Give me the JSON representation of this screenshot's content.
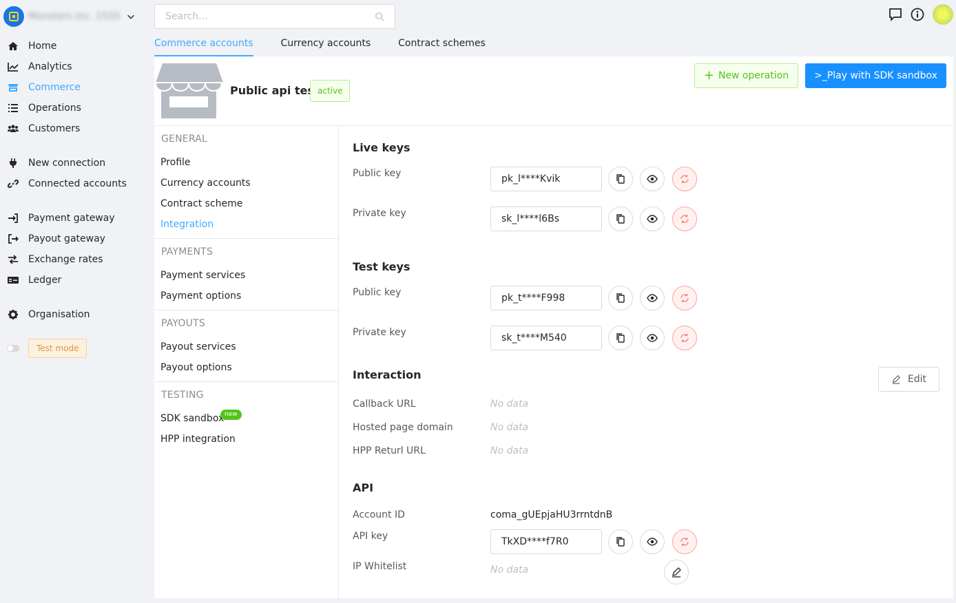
{
  "org": {
    "name": "Monsters Inc. 1555"
  },
  "sidebar": {
    "items": [
      {
        "label": "Home",
        "icon": "home-icon"
      },
      {
        "label": "Analytics",
        "icon": "chart-line-icon"
      },
      {
        "label": "Commerce",
        "icon": "store-icon"
      },
      {
        "label": "Operations",
        "icon": "list-icon"
      },
      {
        "label": "Customers",
        "icon": "users-icon"
      },
      {
        "label": "New connection",
        "icon": "plug-icon"
      },
      {
        "label": "Connected accounts",
        "icon": "link-icon"
      },
      {
        "label": "Payment gateway",
        "icon": "sign-in-icon"
      },
      {
        "label": "Payout gateway",
        "icon": "sign-out-icon"
      },
      {
        "label": "Exchange rates",
        "icon": "exchange-icon"
      },
      {
        "label": "Ledger",
        "icon": "money-bill-icon"
      },
      {
        "label": "Organisation",
        "icon": "gear-icon"
      }
    ],
    "test_mode_label": "Test mode"
  },
  "search": {
    "placeholder": "Search..."
  },
  "tabs": [
    {
      "label": "Commerce accounts"
    },
    {
      "label": "Currency accounts"
    },
    {
      "label": "Contract schemes"
    }
  ],
  "account": {
    "title": "Public api test",
    "status": "active",
    "new_operation_label": "New operation",
    "sdk_sandbox_label": "Play with SDK sandbox",
    "sdk_prompt": ">_"
  },
  "subnav": {
    "groups": [
      {
        "head": "GENERAL",
        "items": [
          "Profile",
          "Currency accounts",
          "Contract scheme",
          "Integration"
        ]
      },
      {
        "head": "PAYMENTS",
        "items": [
          "Payment services",
          "Payment options"
        ]
      },
      {
        "head": "PAYOUTS",
        "items": [
          "Payout services",
          "Payout options"
        ]
      },
      {
        "head": "TESTING",
        "items": [
          "SDK sandbox",
          "HPP integration"
        ]
      }
    ],
    "new_badge": "new"
  },
  "live_keys": {
    "title": "Live keys",
    "public_label": "Public key",
    "public_value": "pk_l****Kvik",
    "private_label": "Private key",
    "private_value": "sk_l****l6Bs"
  },
  "test_keys": {
    "title": "Test keys",
    "public_label": "Public key",
    "public_value": "pk_t****F998",
    "private_label": "Private key",
    "private_value": "sk_t****M540"
  },
  "interaction": {
    "title": "Interaction",
    "edit_label": "Edit",
    "callback_label": "Callback URL",
    "hosted_label": "Hosted page domain",
    "hpp_label": "HPP Returl URL",
    "no_data": "No data"
  },
  "api": {
    "title": "API",
    "account_id_label": "Account ID",
    "account_id_value": "coma_gUEpjaHU3rrntdnB",
    "api_key_label": "API key",
    "api_key_value": "TkXD****f7R0",
    "ip_label": "IP Whitelist",
    "no_data": "No data"
  },
  "colors": {
    "accent": "#40a9ff",
    "primary": "#1890ff",
    "success": "#52c41a",
    "danger": "#ff7875"
  }
}
